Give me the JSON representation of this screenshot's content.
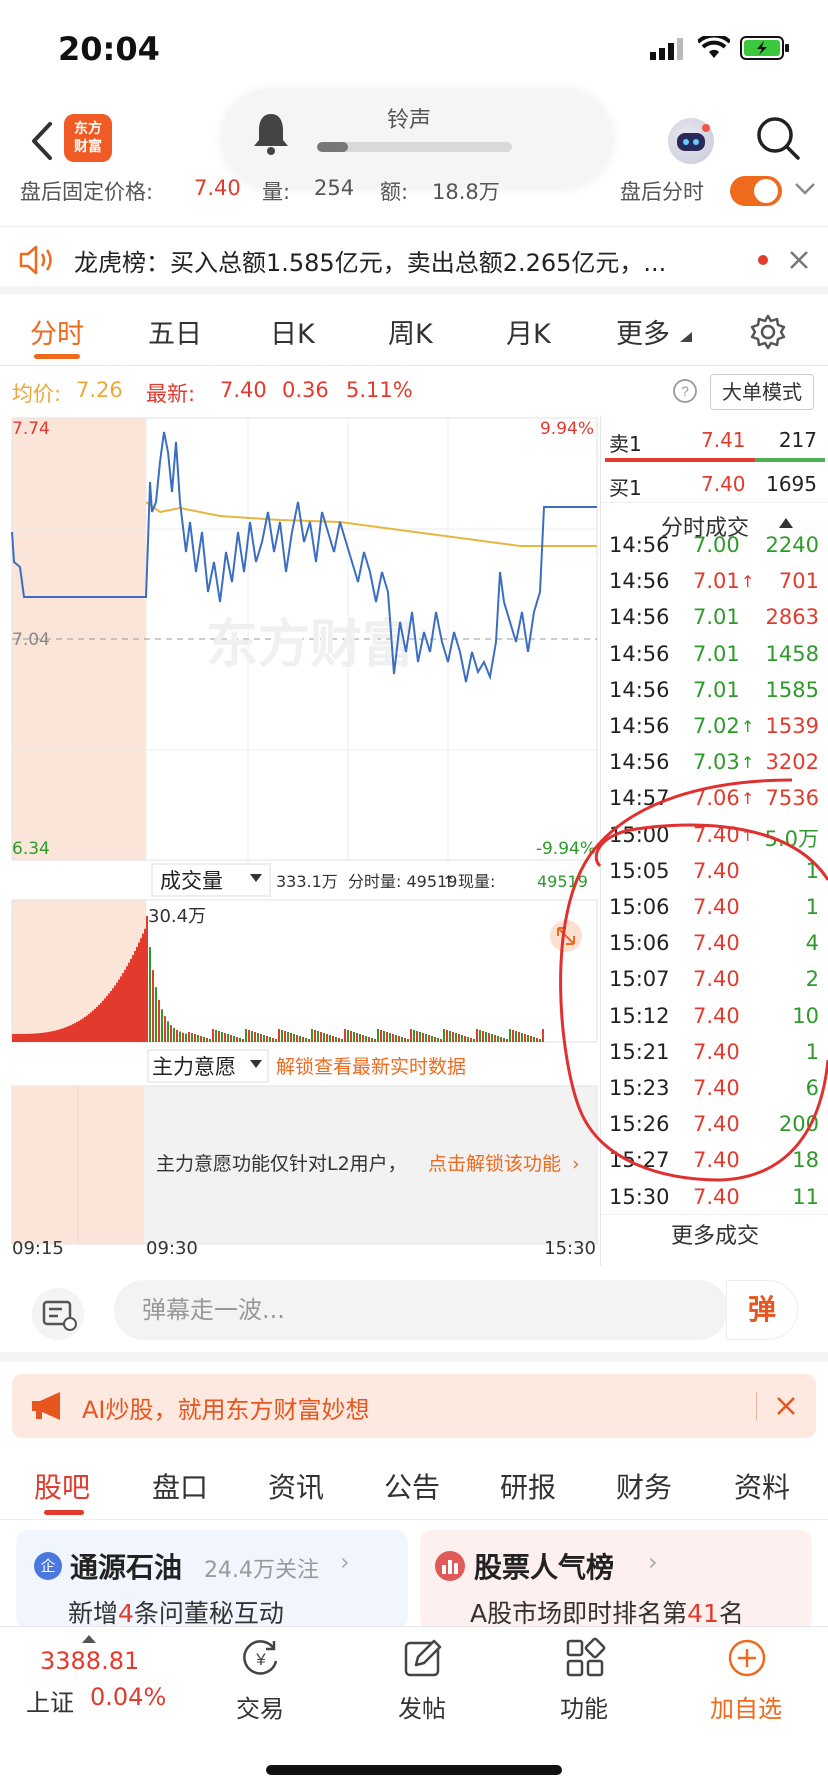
{
  "status": {
    "time": "20:04"
  },
  "nav": {
    "logo_line1": "东方",
    "logo_line2": "财富",
    "ringtone_label": "铃声",
    "ringtone_progress": 0.16
  },
  "after_hours": {
    "price_label": "盘后固定价格:",
    "price": "7.40",
    "vol_label": "量:",
    "vol": "254",
    "amt_label": "额:",
    "amt": "18.8万",
    "toggle_label": "盘后分时"
  },
  "dragon": {
    "text": "龙虎榜：买入总额1.585亿元，卖出总额2.265亿元，..."
  },
  "tabs": [
    "分时",
    "五日",
    "日K",
    "周K",
    "月K",
    "更多"
  ],
  "info": {
    "avg_label": "均价:",
    "avg": "7.26",
    "last_label": "最新:",
    "last": "7.40",
    "chg": "0.36",
    "pct": "5.11%",
    "big_order": "大单模式"
  },
  "chart": {
    "y_top": "7.74",
    "y_mid": "7.04",
    "y_bottom": "6.34",
    "pct_top": "9.94%",
    "pct_bottom": "-9.94%",
    "watermark": "东方财富",
    "vol_selector": "成交量",
    "vol_info_total": "333.1万",
    "vol_info_mid": "分时量: 49519",
    "vol_info_now_label": "现量:",
    "vol_info_now": "49519",
    "vol_max": "30.4万",
    "main_selector": "主力意愿",
    "unlock": "解锁查看最新实时数据",
    "l2_notice": "主力意愿功能仅针对L2用户，",
    "l2_link": "点击解锁该功能",
    "times": [
      "09:15",
      "09:30",
      "15:30"
    ]
  },
  "book": {
    "sell1_label": "卖1",
    "sell1_price": "7.41",
    "sell1_vol": "217",
    "buy1_label": "买1",
    "buy1_price": "7.40",
    "buy1_vol": "1695",
    "trades_title": "分时成交",
    "trades": [
      {
        "t": "14:56",
        "p": "7.00",
        "v": "2240",
        "pc": "green",
        "vc": "green",
        "arrow": ""
      },
      {
        "t": "14:56",
        "p": "7.01",
        "v": "701",
        "pc": "red",
        "vc": "red",
        "arrow": "↑"
      },
      {
        "t": "14:56",
        "p": "7.01",
        "v": "2863",
        "pc": "green",
        "vc": "red",
        "arrow": ""
      },
      {
        "t": "14:56",
        "p": "7.01",
        "v": "1458",
        "pc": "green",
        "vc": "green",
        "arrow": ""
      },
      {
        "t": "14:56",
        "p": "7.01",
        "v": "1585",
        "pc": "green",
        "vc": "green",
        "arrow": ""
      },
      {
        "t": "14:56",
        "p": "7.02",
        "v": "1539",
        "pc": "green",
        "vc": "red",
        "arrow": "↑"
      },
      {
        "t": "14:56",
        "p": "7.03",
        "v": "3202",
        "pc": "green",
        "vc": "red",
        "arrow": "↑"
      },
      {
        "t": "14:57",
        "p": "7.06",
        "v": "7536",
        "pc": "red",
        "vc": "red",
        "arrow": "↑"
      },
      {
        "t": "15:00",
        "p": "7.40",
        "v": "5.0万",
        "pc": "red",
        "vc": "green",
        "arrow": "↑"
      },
      {
        "t": "15:05",
        "p": "7.40",
        "v": "1",
        "pc": "red",
        "vc": "green",
        "arrow": ""
      },
      {
        "t": "15:06",
        "p": "7.40",
        "v": "1",
        "pc": "red",
        "vc": "green",
        "arrow": ""
      },
      {
        "t": "15:06",
        "p": "7.40",
        "v": "4",
        "pc": "red",
        "vc": "green",
        "arrow": ""
      },
      {
        "t": "15:07",
        "p": "7.40",
        "v": "2",
        "pc": "red",
        "vc": "green",
        "arrow": ""
      },
      {
        "t": "15:12",
        "p": "7.40",
        "v": "10",
        "pc": "red",
        "vc": "green",
        "arrow": ""
      },
      {
        "t": "15:21",
        "p": "7.40",
        "v": "1",
        "pc": "red",
        "vc": "green",
        "arrow": ""
      },
      {
        "t": "15:23",
        "p": "7.40",
        "v": "6",
        "pc": "red",
        "vc": "green",
        "arrow": ""
      },
      {
        "t": "15:26",
        "p": "7.40",
        "v": "200",
        "pc": "red",
        "vc": "green",
        "arrow": ""
      },
      {
        "t": "15:27",
        "p": "7.40",
        "v": "18",
        "pc": "red",
        "vc": "green",
        "arrow": ""
      },
      {
        "t": "15:30",
        "p": "7.40",
        "v": "11",
        "pc": "red",
        "vc": "green",
        "arrow": ""
      }
    ],
    "more": "更多成交"
  },
  "danmu": {
    "placeholder": "弹幕走一波...",
    "send": "弹"
  },
  "ai": {
    "text": "AI炒股，就用东方财富妙想"
  },
  "lower_tabs": [
    "股吧",
    "盘口",
    "资讯",
    "公告",
    "研报",
    "财务",
    "资料"
  ],
  "cards": {
    "left_badge": "企",
    "left_title": "通源石油",
    "left_follow": "24.4万关注",
    "left_sub_a": "新增",
    "left_sub_n": "4",
    "left_sub_b": "条问董秘互动",
    "right_title": "股票人气榜",
    "right_sub_a": "A股市场即时排名第",
    "right_sub_n": "41",
    "right_sub_b": "名"
  },
  "bottom": {
    "index_value": "3388.81",
    "index_name": "上证",
    "index_pct": "0.04%",
    "trade": "交易",
    "post": "发帖",
    "func": "功能",
    "add": "加自选"
  },
  "colors": {
    "accent": "#f06a1d",
    "up": "#e23b2e",
    "down": "#2e9a2a",
    "price_line": "#3b6ec2",
    "avg_line": "#e8b640"
  }
}
